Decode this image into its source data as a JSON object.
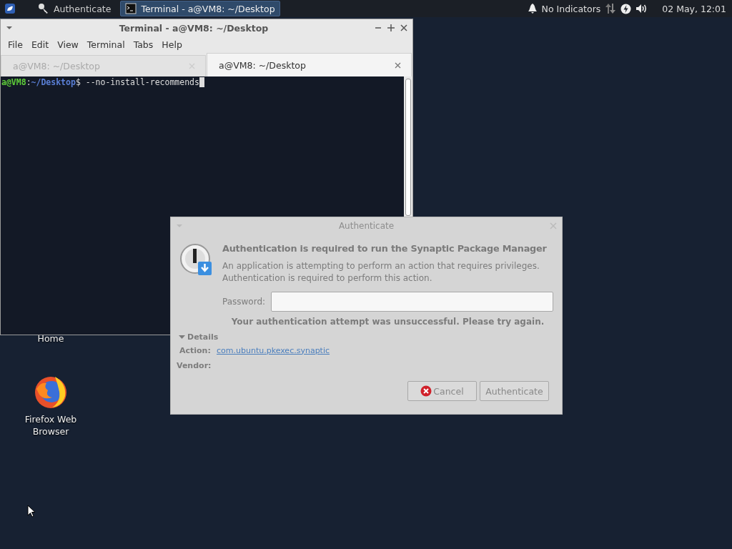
{
  "panel": {
    "tasks": [
      {
        "label": "Authenticate",
        "kind": "key",
        "selected": false
      },
      {
        "label": "Terminal - a@VM8: ~/Desktop",
        "kind": "terminal",
        "selected": true
      }
    ],
    "indicators": "No Indicators",
    "clock": "02 May, 12:01"
  },
  "desktop_icons": [
    {
      "label": "Home",
      "kind": "home"
    },
    {
      "label": "Firefox Web Browser",
      "kind": "browser"
    }
  ],
  "terminal": {
    "title": "Terminal - a@VM8: ~/Desktop",
    "menu": [
      "File",
      "Edit",
      "View",
      "Terminal",
      "Tabs",
      "Help"
    ],
    "tabs": [
      {
        "label": "a@VM8: ~/Desktop",
        "selected": false
      },
      {
        "label": "a@VM8: ~/Desktop",
        "selected": true
      }
    ],
    "prompt": {
      "user": "a@VM8",
      "separator": ":",
      "path": "~/Desktop",
      "symbol": "$",
      "command": " --no-install-recommends"
    }
  },
  "dialog": {
    "title": "Authenticate",
    "heading": "Authentication is required to run the Synaptic Package Manager",
    "message": [
      "An application is attempting to perform an action that requires privileges.",
      "Authentication is required to perform this action."
    ],
    "password_label": "Password:",
    "error": "Your authentication attempt was unsuccessful. Please try again.",
    "details_label": "Details",
    "details_expanded": true,
    "details": [
      {
        "label": "Action:",
        "value": "com.ubuntu.pkexec.synaptic",
        "kind": "link"
      },
      {
        "label": "Vendor:",
        "kind": "text"
      }
    ],
    "buttons": [
      {
        "label": "Cancel",
        "kind": "cancel"
      },
      {
        "label": "Authenticate",
        "kind": "plain"
      }
    ]
  }
}
